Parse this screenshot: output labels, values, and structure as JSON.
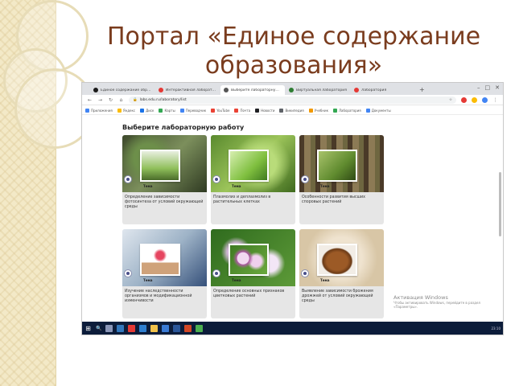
{
  "slide": {
    "title": "Портал «Единое содержание образования»"
  },
  "browser": {
    "tabs": [
      {
        "label": "Единое содержание образования",
        "active": false,
        "fav_color": "#1a1a1a"
      },
      {
        "label": "Интерактивная лаборатория",
        "active": false,
        "fav_color": "#e53935"
      },
      {
        "label": "Выберите лабораторную работу",
        "active": true,
        "fav_color": "#555555"
      },
      {
        "label": "Виртуальная лаборатория",
        "active": false,
        "fav_color": "#2e7d32"
      },
      {
        "label": "Лаборатория",
        "active": false,
        "fav_color": "#e53935"
      }
    ],
    "new_tab": "+",
    "window_controls": [
      "–",
      "□",
      "✕"
    ],
    "address": "labs.edu.ru/laboratory/list",
    "nav": {
      "back": "←",
      "forward": "→",
      "reload": "↻",
      "home": "⌂"
    },
    "bookmarks": [
      {
        "label": "Приложения",
        "color": "#4285f4"
      },
      {
        "label": "Яндекс",
        "color": "#fbbc05"
      },
      {
        "label": "Диск",
        "color": "#1a73e8"
      },
      {
        "label": "Карты",
        "color": "#34a853"
      },
      {
        "label": "Переводчик",
        "color": "#4285f4"
      },
      {
        "label": "YouTube",
        "color": "#ea4335"
      },
      {
        "label": "Почта",
        "color": "#ea4335"
      },
      {
        "label": "Новости",
        "color": "#202124"
      },
      {
        "label": "Википедия",
        "color": "#5f6368"
      },
      {
        "label": "Учебник",
        "color": "#f29900"
      },
      {
        "label": "Лаборатория",
        "color": "#34a853"
      },
      {
        "label": "Документы",
        "color": "#4285f4"
      }
    ]
  },
  "page": {
    "heading": "Выберите лабораторную работу",
    "cards": [
      {
        "tag": "Тема",
        "title": "Определение зависимости фотосинтеза от условий окружающей среды",
        "photo": "forest-seedlings",
        "thumb": "seedlings-green"
      },
      {
        "tag": "Тема",
        "title": "Плазмолиз и деплазмолиз в растительных клетках",
        "photo": "green-plants",
        "thumb": "green-leaves"
      },
      {
        "tag": "Тема",
        "title": "Особенности развития высших споровых растений",
        "photo": "tree-trunks",
        "thumb": "moss-ferns"
      },
      {
        "tag": "Тема",
        "title": "Изучение наследственности организмов и модификационной изменчивости",
        "photo": "lab-flask",
        "thumb": "red-flower-pot"
      },
      {
        "tag": "Тема",
        "title": "Определение основных признаков цветковых растений",
        "photo": "daisies",
        "thumb": "pink-daisies"
      },
      {
        "tag": "Тема",
        "title": "Выявление зависимости брожения дрожжей от условий окружающей среды",
        "photo": "dough",
        "thumb": "bread-loaf"
      }
    ],
    "activation": {
      "title": "Активация Windows",
      "subtitle": "Чтобы активировать Windows, перейдите в раздел «Параметры»."
    }
  },
  "taskbar": {
    "start": "⊞",
    "search": "🔍",
    "apps": [
      {
        "name": "task-view",
        "color": "#8a96b8"
      },
      {
        "name": "edge",
        "color": "#3277bc"
      },
      {
        "name": "yandex",
        "color": "#e53935"
      },
      {
        "name": "store",
        "color": "#2f7fd0"
      },
      {
        "name": "explorer",
        "color": "#f0c14b"
      },
      {
        "name": "mail",
        "color": "#3a7bd5"
      },
      {
        "name": "word",
        "color": "#2b579a"
      },
      {
        "name": "powerpoint",
        "color": "#d24726"
      },
      {
        "name": "chrome",
        "color": "#4caf50"
      }
    ],
    "tray": "23:10"
  },
  "colors": {
    "title": "#7a3c1e",
    "card_bg": "#e6e6e6",
    "taskbar": "#0c1c3a"
  }
}
